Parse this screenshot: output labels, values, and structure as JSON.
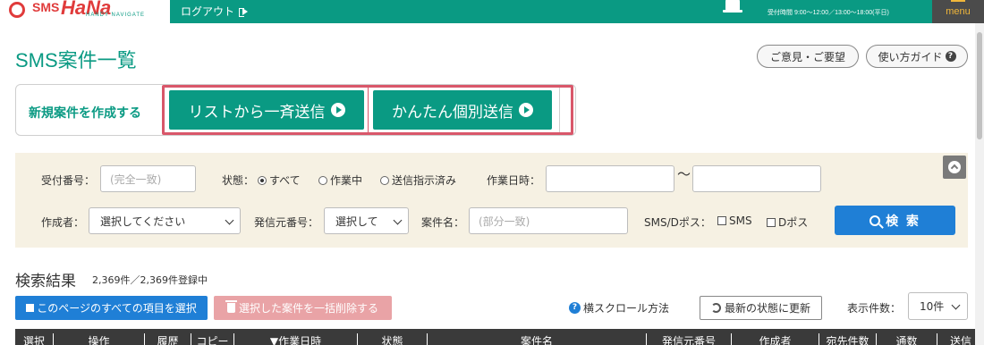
{
  "header": {
    "logo_sms": "SMS",
    "logo_hana": "HaNa",
    "logo_sub": "HANDY NAVIGATE",
    "logout_label": "ログアウト",
    "hours": "受付時間 9:00〜12:00／13:00〜18:00(平日)",
    "menu_label": "menu",
    "brand_color": "#0a9a83"
  },
  "page": {
    "title": "SMS案件一覧",
    "feedback_label": "ご意見・ご要望",
    "guide_label": "使い方ガイド"
  },
  "create": {
    "label": "新規案件を作成する",
    "list_send_label": "リストから一斉送信",
    "individual_send_label": "かんたん個別送信",
    "highlight_color": "#d9576a"
  },
  "search": {
    "reception_no_label": "受付番号：",
    "reception_no_placeholder": "(完全一致)",
    "status_label": "状態：",
    "status_options": [
      "すべて",
      "作業中",
      "送信指示済み"
    ],
    "status_selected": "すべて",
    "work_datetime_label": "作業日時：",
    "range_separator": "〜",
    "creator_label": "作成者：",
    "creator_value": "選択してください",
    "sender_no_label": "発信元番号：",
    "sender_no_value": "選択して",
    "case_name_label": "案件名：",
    "case_name_placeholder": "(部分一致)",
    "sms_dbox_label": "SMS/Dポス：",
    "sms_option": "SMS",
    "dbox_option": "Dポス",
    "search_button": "検 索"
  },
  "results": {
    "title": "検索結果",
    "count": "2,369件／2,369件登録中",
    "select_all_label": "このページのすべての項目を選択",
    "bulk_delete_label": "選択した案件を一括削除する",
    "scroll_help_label": "横スクロール方法",
    "refresh_label": "最新の状態に更新",
    "per_page_label": "表示件数：",
    "per_page_value": "10件"
  },
  "table": {
    "columns": [
      "選択",
      "操作",
      "履歴",
      "コピー",
      "▼作業日時",
      "状態",
      "案件名",
      "発信元番号",
      "作成者",
      "宛先件数",
      "通数",
      "送信"
    ]
  }
}
